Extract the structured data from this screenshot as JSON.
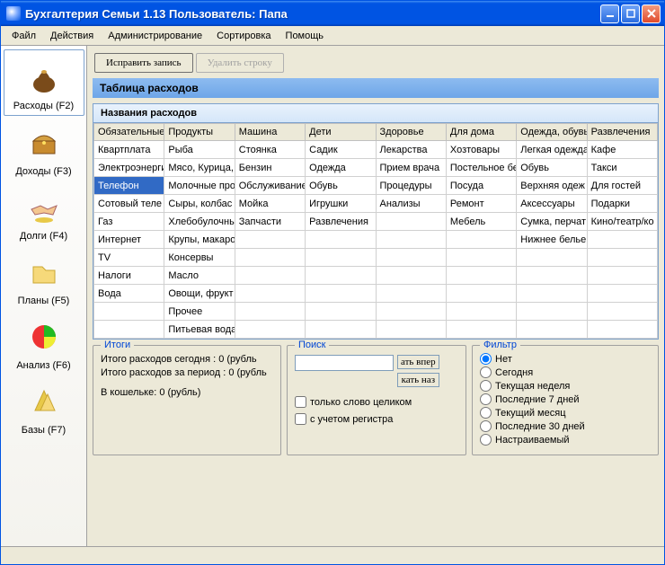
{
  "window": {
    "title": "Бухгалтерия Семьи 1.13     Пользователь: Папа"
  },
  "menu": [
    "Файл",
    "Действия",
    "Администрирование",
    "Сортировка",
    "Помощь"
  ],
  "sidebar": [
    {
      "label": "Расходы (F2)",
      "name": "sidebar-item-expenses",
      "active": true,
      "icon": "bag"
    },
    {
      "label": "Доходы (F3)",
      "name": "sidebar-item-income",
      "icon": "chest"
    },
    {
      "label": "Долги (F4)",
      "name": "sidebar-item-debts",
      "icon": "handshake"
    },
    {
      "label": "Планы (F5)",
      "name": "sidebar-item-plans",
      "icon": "folder"
    },
    {
      "label": "Анализ (F6)",
      "name": "sidebar-item-analysis",
      "icon": "piechart"
    },
    {
      "label": "Базы (F7)",
      "name": "sidebar-item-bases",
      "icon": "cabinet"
    }
  ],
  "toolbar": {
    "edit_label": "Исправить запись",
    "delete_label": "Удалить строку"
  },
  "heading": "Таблица расходов",
  "section_title": "Названия расходов",
  "columns": [
    "Обязательные",
    "Продукты",
    "Машина",
    "Дети",
    "Здоровье",
    "Для дома",
    "Одежда, обувь",
    "Развлечения"
  ],
  "rows": [
    [
      "Квартплата",
      "Рыба",
      "Стоянка",
      "Садик",
      "Лекарства",
      "Хозтовары",
      "Легкая одежда",
      "Кафе"
    ],
    [
      "Электроэнергия",
      "Мясо, Курица,",
      "Бензин",
      "Одежда",
      "Прием врача",
      "Постельное бе",
      "Обувь",
      "Такси"
    ],
    [
      "Телефон",
      "Молочные про",
      "Обслуживание",
      "Обувь",
      "Процедуры",
      "Посуда",
      "Верхняя одеж",
      "Для гостей"
    ],
    [
      "Сотовый теле",
      "Сыры, колбас",
      "Мойка",
      "Игрушки",
      "Анализы",
      "Ремонт",
      "Аксессуары",
      "Подарки"
    ],
    [
      "Газ",
      "Хлебобулочны",
      "Запчасти",
      "Развлечения",
      "",
      "Мебель",
      "Сумка, перчат",
      "Кино/театр/ко"
    ],
    [
      "Интернет",
      "Крупы, макаро",
      "",
      "",
      "",
      "",
      "Нижнее белье",
      ""
    ],
    [
      "TV",
      "Консервы",
      "",
      "",
      "",
      "",
      "",
      ""
    ],
    [
      "Налоги",
      "Масло",
      "",
      "",
      "",
      "",
      "",
      ""
    ],
    [
      "Вода",
      "Овощи, фрукт",
      "",
      "",
      "",
      "",
      "",
      ""
    ],
    [
      "",
      "Прочее",
      "",
      "",
      "",
      "",
      "",
      ""
    ],
    [
      "",
      "Питьевая вода",
      "",
      "",
      "",
      "",
      "",
      ""
    ]
  ],
  "selected_cell": {
    "row": 2,
    "col": 0
  },
  "itogi": {
    "legend": "Итоги",
    "line1": "Итого расходов сегодня : 0 (рубль",
    "line2": "Итого расходов за период : 0 (рубль",
    "line3": "В кошельке: 0 (рубль)"
  },
  "poisk": {
    "legend": "Поиск",
    "btn_forward": "ать впер",
    "btn_back": "кать наз",
    "chk_whole": "только слово целиком",
    "chk_case": "с учетом регистра"
  },
  "filter": {
    "legend": "Фильтр",
    "options": [
      "Нет",
      "Сегодня",
      "Текущая неделя",
      "Последние 7 дней",
      "Текущий месяц",
      "Последние 30 дней",
      "Настраиваемый"
    ],
    "selected": 0
  }
}
